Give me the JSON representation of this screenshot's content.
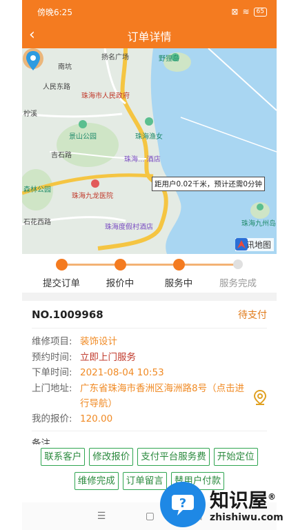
{
  "status_bar": {
    "time": "傍晚6:25",
    "battery": "65"
  },
  "header": {
    "title": "订单详情"
  },
  "map": {
    "labels": {
      "yangming": "扬名广场",
      "yeli": "野狸岛",
      "nanxi": "南坑",
      "renmin_road": "人民东路",
      "gov": "珠海市人民政府",
      "zhexi": "柠溪",
      "yunu": "珠海渔女",
      "jingshan": "景山公园",
      "jishi": "吉石路",
      "hotel": "珠海... 酒店",
      "forest": "森林公园",
      "jiulong": "珠海九龙医院",
      "shihua": "石花西路",
      "resort": "珠海度假村酒店",
      "jiuzhou": "珠海九州岛"
    },
    "distance_tip": "距用户0.02千米，预计还需0分钟",
    "brand": "腾讯地图"
  },
  "progress": {
    "steps": [
      "提交订单",
      "报价中",
      "服务中",
      "服务完成"
    ],
    "completed_count": 3
  },
  "order": {
    "number": "NO.1009968",
    "status": "待支付",
    "fields": [
      {
        "key": "维修项目:",
        "value": "装饰设计"
      },
      {
        "key": "预约时间:",
        "value": "立即上门服务"
      },
      {
        "key": "下单时间:",
        "value": "2021-08-04 10:53"
      },
      {
        "key": "上门地址:",
        "value": "广东省珠海市香洲区海洲路8号（点击进行导航）"
      },
      {
        "key": "我的报价:",
        "value": "120.00"
      }
    ],
    "remark_label": "备注"
  },
  "actions": {
    "row1": [
      "联系客户",
      "修改报价",
      "支付平台服务费",
      "开始定位"
    ],
    "row2": [
      "维修完成",
      "订单留言",
      "替用户付款"
    ]
  },
  "nav": {
    "menu": "☰",
    "home": "▢",
    "back": "◁"
  },
  "watermark": {
    "cn": "知识屋",
    "en": "zhishiwu.com",
    "reg": "®"
  },
  "colors": {
    "brand_orange": "#f47b20",
    "action_green": "#2ea44f",
    "value_orange": "#f08a24",
    "value_red": "#c0392b"
  }
}
